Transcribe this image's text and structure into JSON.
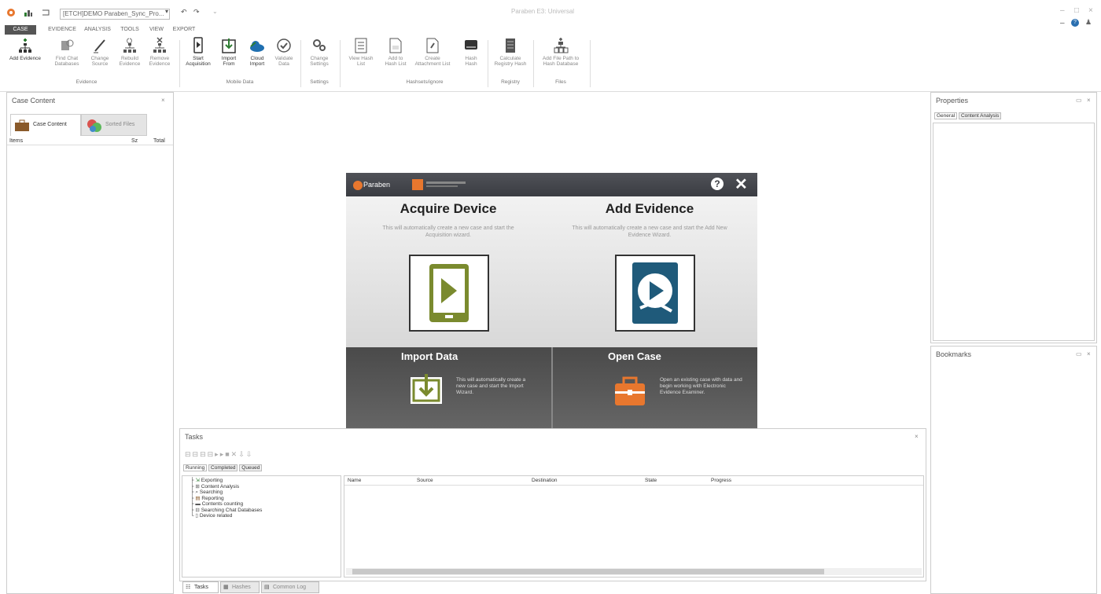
{
  "titlebar": {
    "case_combo": "[ETCH]DEMO Paraben_Sync_Pro...",
    "app_title": "Paraben E3: Universal",
    "controls": [
      "–",
      "□",
      "×"
    ],
    "help_icons": [
      "–",
      "?",
      "👤"
    ]
  },
  "ribbon_tabs": [
    "CASE",
    "EVIDENCE",
    "ANALYSIS",
    "TOOLS",
    "VIEW",
    "EXPORT"
  ],
  "ribbon": {
    "groups": [
      {
        "label": "Evidence",
        "buttons": [
          "Add Evidence",
          "Find Chat Databases",
          "Change Source",
          "Rebuild Evidence",
          "Remove Evidence"
        ]
      },
      {
        "label": "Mobile Data",
        "buttons": [
          "Start Acquisition",
          "Import From",
          "Cloud Import",
          "Validate Data"
        ]
      },
      {
        "label": "Settings",
        "buttons": [
          "Change Settings"
        ]
      },
      {
        "label": "Hashsets/ignore",
        "buttons": [
          "View Hash List",
          "Add to Hash List",
          "Create Attachment List",
          "Hash Hash"
        ]
      },
      {
        "label": "Registry",
        "buttons": [
          "Calculate Registry Hash"
        ]
      },
      {
        "label": "Files",
        "buttons": [
          "Add File Path to Hash Database"
        ]
      }
    ]
  },
  "left_panel": {
    "title": "Case Content",
    "tabs": [
      "Case Content",
      "Sorted Files"
    ],
    "columns": [
      "Items",
      "Sz",
      "Total"
    ]
  },
  "dialog": {
    "brand": "Paraben",
    "acquire_title": "Acquire Device",
    "acquire_desc": "This will automatically create a new case and start the Acquisition wizard.",
    "evidence_title": "Add Evidence",
    "evidence_desc": "This will automatically create a new case and start the Add New Evidence Wizard.",
    "import_title": "Import Data",
    "import_desc": "This will automatically create a new case and start the Import Wizard.",
    "open_title": "Open Case",
    "open_desc": "Open an existing case with data and begin working with Electronic Evidence Examiner."
  },
  "tasks": {
    "title": "Tasks",
    "subtabs": [
      "Running",
      "Completed",
      "Queued"
    ],
    "tree": [
      "Exporting",
      "Content Analysis",
      "Searching",
      "Reporting",
      "Contents counting",
      "Searching Chat Databases",
      "Device related"
    ],
    "columns": [
      "Name",
      "Source",
      "Destination",
      "State",
      "Progress"
    ]
  },
  "bottom_tabs": [
    "Tasks",
    "Hashes",
    "Common Log"
  ],
  "properties": {
    "title": "Properties",
    "tabs": [
      "General",
      "Content Analysis"
    ]
  },
  "bookmarks": {
    "title": "Bookmarks"
  },
  "colors": {
    "accent_orange": "#e8772e",
    "android_green": "#7a8a2e",
    "evidence_blue": "#1f5a7a",
    "dialog_dark": "#3c3e44"
  }
}
